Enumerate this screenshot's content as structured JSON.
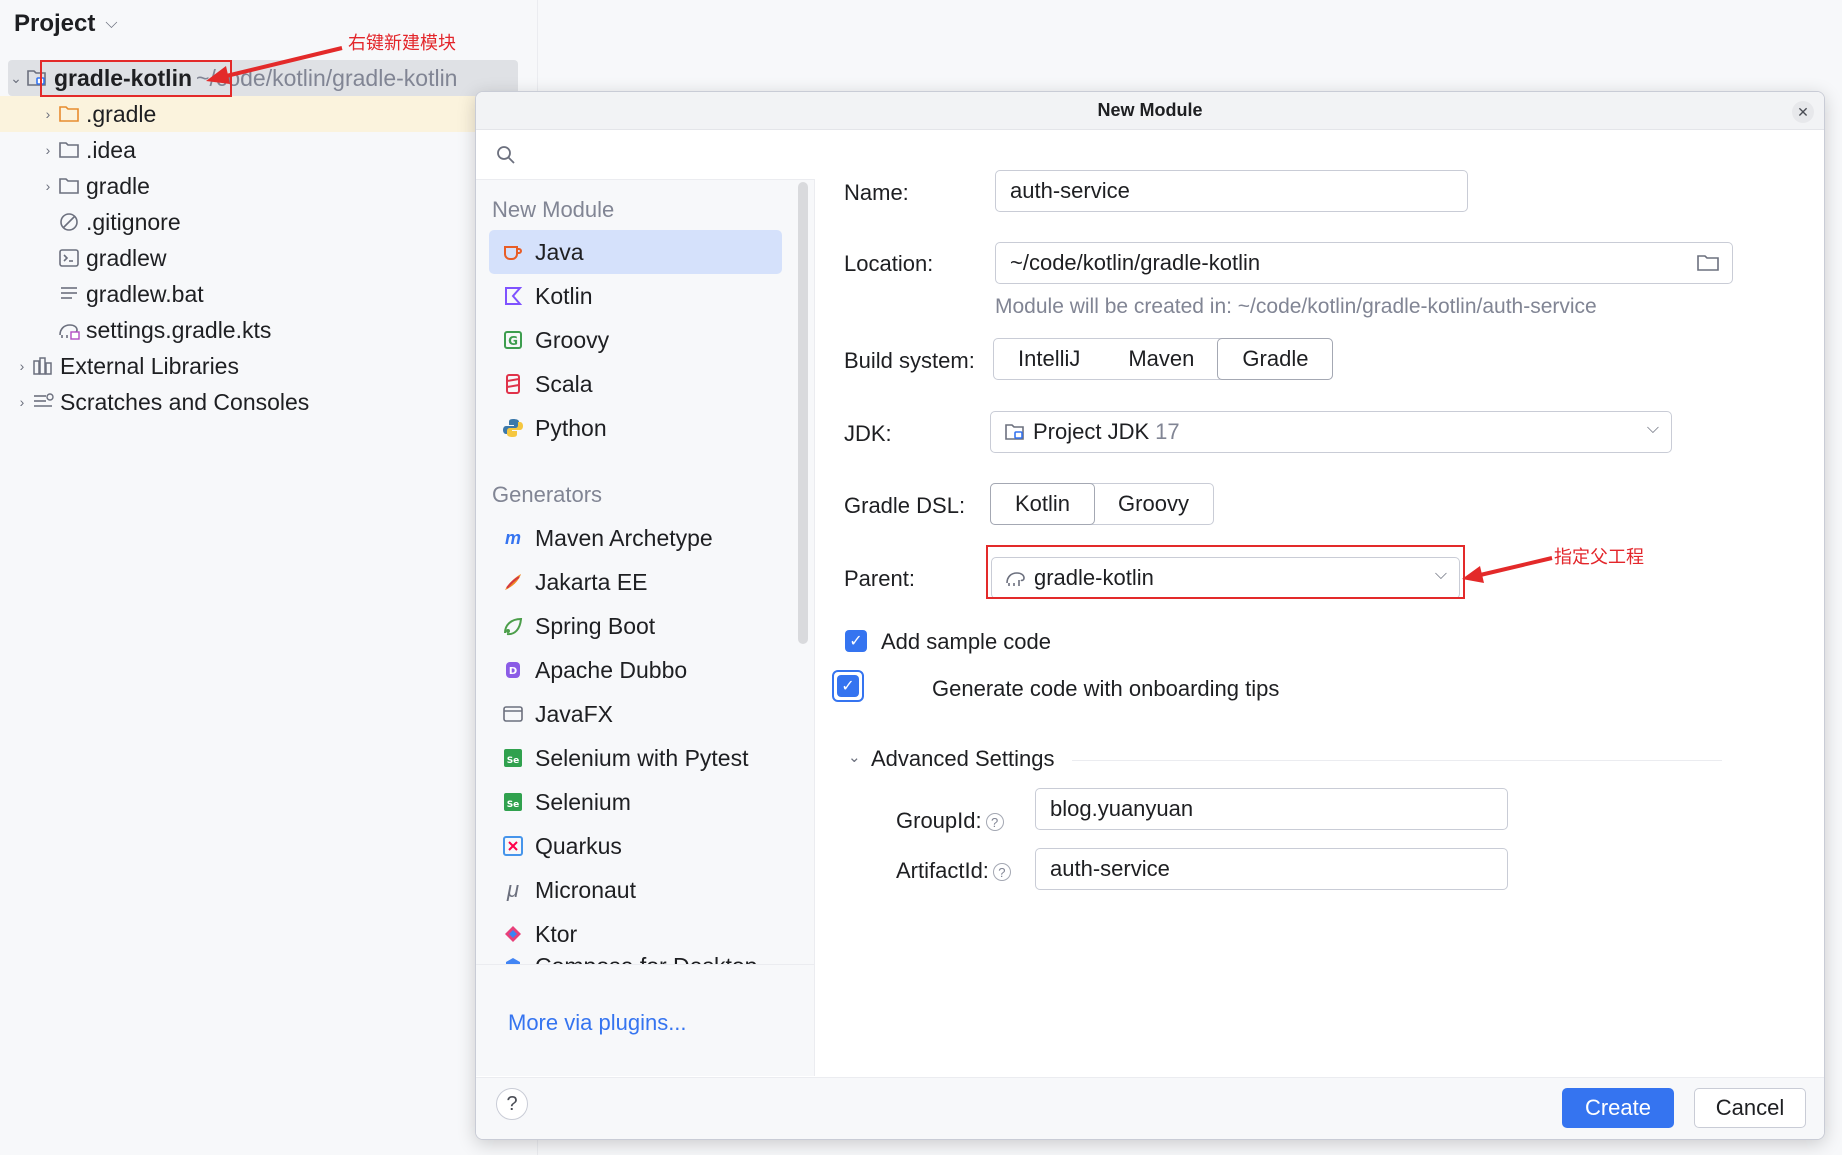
{
  "project_panel": {
    "title": "Project",
    "root": {
      "name": "gradle-kotlin",
      "path": "~/code/kotlin/gradle-kotlin"
    },
    "children": [
      ".gradle",
      ".idea",
      "gradle",
      ".gitignore",
      "gradlew",
      "gradlew.bat",
      "settings.gradle.kts"
    ],
    "external_libraries": "External Libraries",
    "scratches": "Scratches and Consoles"
  },
  "annotations": {
    "right_click_new_module": "右键新建模块",
    "specify_parent": "指定父工程"
  },
  "dialog": {
    "title": "New Module",
    "search_placeholder": "",
    "section_new_module": "New Module",
    "module_types": [
      "Java",
      "Kotlin",
      "Groovy",
      "Scala",
      "Python"
    ],
    "section_generators": "Generators",
    "generators": [
      "Maven Archetype",
      "Jakarta EE",
      "Spring Boot",
      "Apache Dubbo",
      "JavaFX",
      "Selenium with Pytest",
      "Selenium",
      "Quarkus",
      "Micronaut",
      "Ktor",
      "Compose for Desktop"
    ],
    "more_plugins": "More via plugins...",
    "form": {
      "name_label": "Name:",
      "name_value": "auth-service",
      "location_label": "Location:",
      "location_value": "~/code/kotlin/gradle-kotlin",
      "location_hint": "Module will be created in: ~/code/kotlin/gradle-kotlin/auth-service",
      "build_system_label": "Build system:",
      "build_systems": [
        "IntelliJ",
        "Maven",
        "Gradle"
      ],
      "jdk_label": "JDK:",
      "jdk_value": "Project JDK",
      "jdk_version": "17",
      "gradle_dsl_label": "Gradle DSL:",
      "gradle_dsl_options": [
        "Kotlin",
        "Groovy"
      ],
      "parent_label": "Parent:",
      "parent_value": "gradle-kotlin",
      "add_sample_code": "Add sample code",
      "onboarding_tips": "Generate code with onboarding tips",
      "advanced_settings": "Advanced Settings",
      "group_id_label": "GroupId:",
      "group_id_value": "blog.yuanyuan",
      "artifact_id_label": "ArtifactId:",
      "artifact_id_value": "auth-service"
    },
    "help": "?",
    "create": "Create",
    "cancel": "Cancel"
  },
  "colors": {
    "accent": "#3574f0",
    "annotation_red": "#e32a2a",
    "selection": "#d5e1fb"
  }
}
